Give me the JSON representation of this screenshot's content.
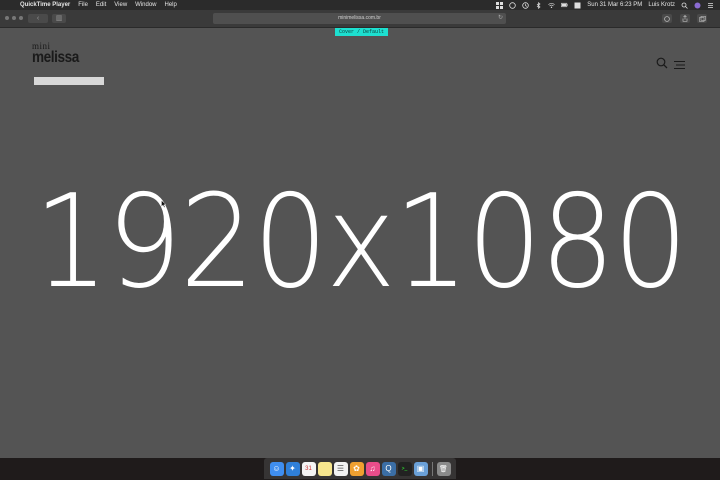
{
  "menubar": {
    "apple_glyph": "",
    "app_name": "QuickTime Player",
    "menus": [
      "File",
      "Edit",
      "View",
      "Window",
      "Help"
    ],
    "status": {
      "time": "Sun 31 Mar  6:23 PM",
      "user": "Luis Krotz"
    }
  },
  "browser": {
    "url": "minimelissa.com.br",
    "back_glyph": "‹",
    "sidebar_glyph": "▥",
    "reload_glyph": "↻"
  },
  "page": {
    "badge": "Cover / Default",
    "logo_top": "mini",
    "logo_bottom": "melissa",
    "placeholder": "1920x1080"
  },
  "dock": {
    "apps": [
      {
        "name": "finder-icon",
        "color": "#3f8ef0",
        "glyph": "☺"
      },
      {
        "name": "safari-icon",
        "color": "#2f7fd8",
        "glyph": "✦"
      },
      {
        "name": "calendar-icon",
        "color": "#f4f4f4",
        "glyph": "31"
      },
      {
        "name": "notes-icon",
        "color": "#f6e58d",
        "glyph": ""
      },
      {
        "name": "reminders-icon",
        "color": "#f2f2f2",
        "glyph": "☰"
      },
      {
        "name": "photos-icon",
        "color": "#f0a030",
        "glyph": "✿"
      },
      {
        "name": "itunes-icon",
        "color": "#e84d8a",
        "glyph": "♫"
      },
      {
        "name": "quicktime-icon",
        "color": "#3b6ea5",
        "glyph": "Q"
      },
      {
        "name": "terminal-icon",
        "color": "#222222",
        "glyph": ">_"
      },
      {
        "name": "preview-icon",
        "color": "#6aa0d8",
        "glyph": "▣"
      },
      {
        "name": "trash-icon",
        "color": "#8a8a8a",
        "glyph": "🗑"
      }
    ]
  }
}
